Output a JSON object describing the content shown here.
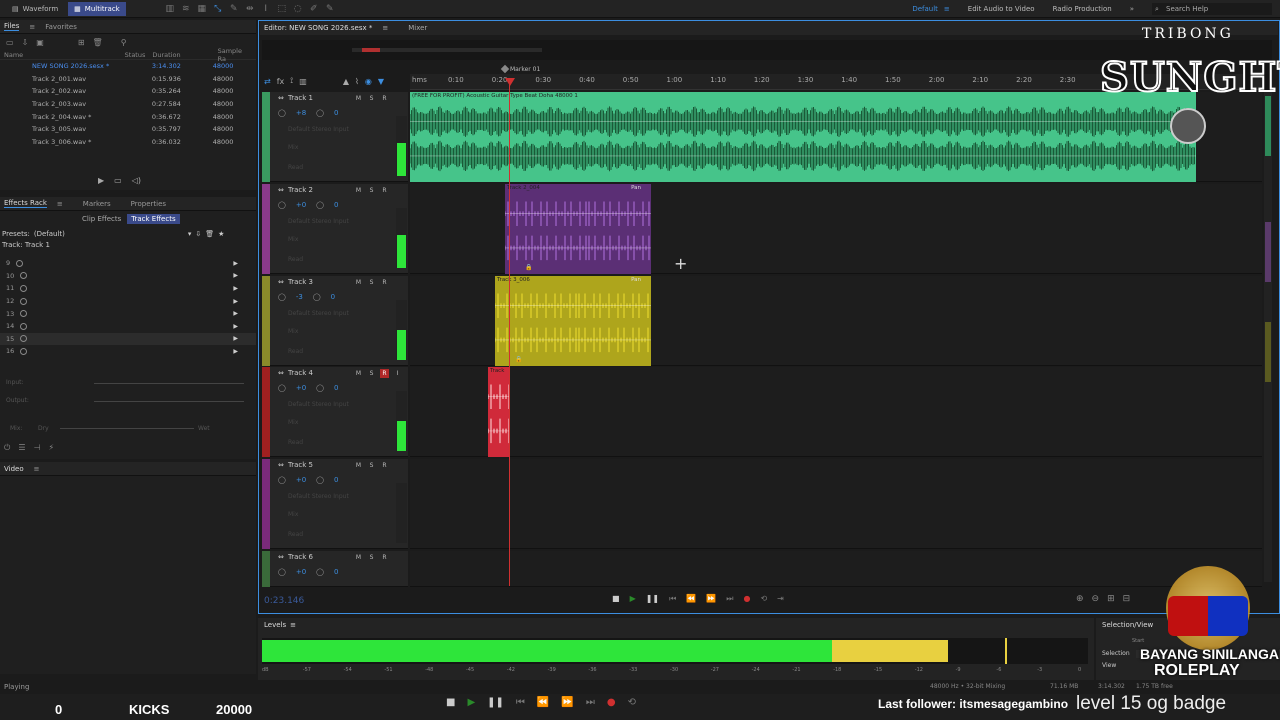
{
  "topbar": {
    "modes": [
      {
        "label": "Waveform",
        "active": false
      },
      {
        "label": "Multitrack",
        "active": true
      }
    ],
    "workspaces": [
      {
        "label": "Default",
        "active": true
      },
      {
        "label": "Edit Audio to Video",
        "active": false
      },
      {
        "label": "Radio Production",
        "active": false
      }
    ],
    "search_placeholder": "Search Help"
  },
  "files_panel": {
    "tabs": [
      "Files",
      "Favorites"
    ],
    "columns": [
      "Name",
      "Status",
      "Duration",
      "Sample Ra"
    ],
    "files": [
      {
        "name": "NEW SONG 2026.sesx *",
        "duration": "3:14.302",
        "rate": "48000",
        "selected": true
      },
      {
        "name": "Track 2_001.wav",
        "duration": "0:15.936",
        "rate": "48000",
        "selected": false
      },
      {
        "name": "Track 2_002.wav",
        "duration": "0:35.264",
        "rate": "48000",
        "selected": false
      },
      {
        "name": "Track 2_003.wav",
        "duration": "0:27.584",
        "rate": "48000",
        "selected": false
      },
      {
        "name": "Track 2_004.wav *",
        "duration": "0:36.672",
        "rate": "48000",
        "selected": false
      },
      {
        "name": "Track 3_005.wav",
        "duration": "0:35.797",
        "rate": "48000",
        "selected": false
      },
      {
        "name": "Track 3_006.wav *",
        "duration": "0:36.032",
        "rate": "48000",
        "selected": false
      }
    ]
  },
  "effects_panel": {
    "tabs": [
      "Effects Rack",
      "Markers",
      "Properties"
    ],
    "subtabs": [
      "Clip Effects",
      "Track Effects"
    ],
    "presets_label": "Presets:",
    "preset_value": "(Default)",
    "track_label": "Track: Track 1",
    "slots": [
      "9",
      "10",
      "11",
      "12",
      "13",
      "14",
      "15",
      "16"
    ],
    "input_label": "Input:",
    "output_label": "Output:",
    "mix_label": "Mix:",
    "dry": "Dry",
    "wet": "Wet"
  },
  "video_panel": {
    "label": "Video"
  },
  "editor": {
    "tabs": [
      "Editor: NEW SONG 2026.sesx *",
      "Mixer"
    ],
    "marker_label": "Marker 01",
    "ruler_unit": "hms",
    "ruler_ticks": [
      "0:10",
      "0:20",
      "0:30",
      "0:40",
      "0:50",
      "1:00",
      "1:10",
      "1:20",
      "1:30",
      "1:40",
      "1:50",
      "2:00",
      "2:10",
      "2:20",
      "2:30"
    ],
    "time": "0:23.146",
    "tracks": [
      {
        "name": "Track 1",
        "vol": "+8",
        "pan": "0",
        "color": "#3a9a60",
        "rec": false,
        "clip": "(FREE FOR PROFIT) Acoustic Guitar Type Beat Doha 48000 1"
      },
      {
        "name": "Track 2",
        "vol": "+0",
        "pan": "0",
        "color": "#8a3a8a",
        "rec": false,
        "clip": "Track 2_004"
      },
      {
        "name": "Track 3",
        "vol": "-3",
        "pan": "0",
        "color": "#8a8a2a",
        "rec": false,
        "clip": "Track 3_006"
      },
      {
        "name": "Track 4",
        "vol": "+0",
        "pan": "0",
        "color": "#a02020",
        "rec": true,
        "clip": "Track"
      },
      {
        "name": "Track 5",
        "vol": "+0",
        "pan": "0",
        "color": "#7a2a7a",
        "rec": false,
        "clip": ""
      },
      {
        "name": "Track 6",
        "vol": "+0",
        "pan": "0",
        "color": "#3a6a3a",
        "rec": false,
        "clip": ""
      }
    ],
    "faded_labels": [
      "Default Stereo Input",
      "Mix",
      "Read"
    ],
    "pan_label": "Pan"
  },
  "levels": {
    "label": "Levels",
    "scale": [
      "dB",
      "-57",
      "-54",
      "-51",
      "-48",
      "-45",
      "-42",
      "-39",
      "-36",
      "-33",
      "-30",
      "-27",
      "-24",
      "-21",
      "-18",
      "-15",
      "-12",
      "-9",
      "-6",
      "-3",
      "0"
    ],
    "level_fraction": 0.77,
    "peak_fraction": 0.9
  },
  "selection_view": {
    "title": "Selection/View",
    "rows": [
      "Selection",
      "View"
    ],
    "start_label": "Start"
  },
  "status": {
    "left": "Playing",
    "format": "48000 Hz • 32-bit Mixing",
    "size": "71.16 MB",
    "duration": "3:14.302",
    "free": "1.75 TB free"
  },
  "overlay": {
    "counter": "0",
    "kicks": "KICKS",
    "kicks_value": "20000",
    "follower": "Last follower: itsmesagegambino",
    "badge": "level 15 og badge",
    "logo_top": "TRIBONG",
    "logo_main": "SUNGHT",
    "logo_bottom_1": "BAYANG SINILANGAN",
    "logo_bottom_2": "ROLEPLAY"
  },
  "colors": {
    "accent": "#3c8ee0",
    "green_wave": "#3ec98a",
    "purple_wave": "#6a3a8a",
    "yellow_wave": "#b8b020",
    "red_clip": "#d02a3a",
    "meter_green": "#2ee53a",
    "meter_yellow": "#e8d040"
  }
}
